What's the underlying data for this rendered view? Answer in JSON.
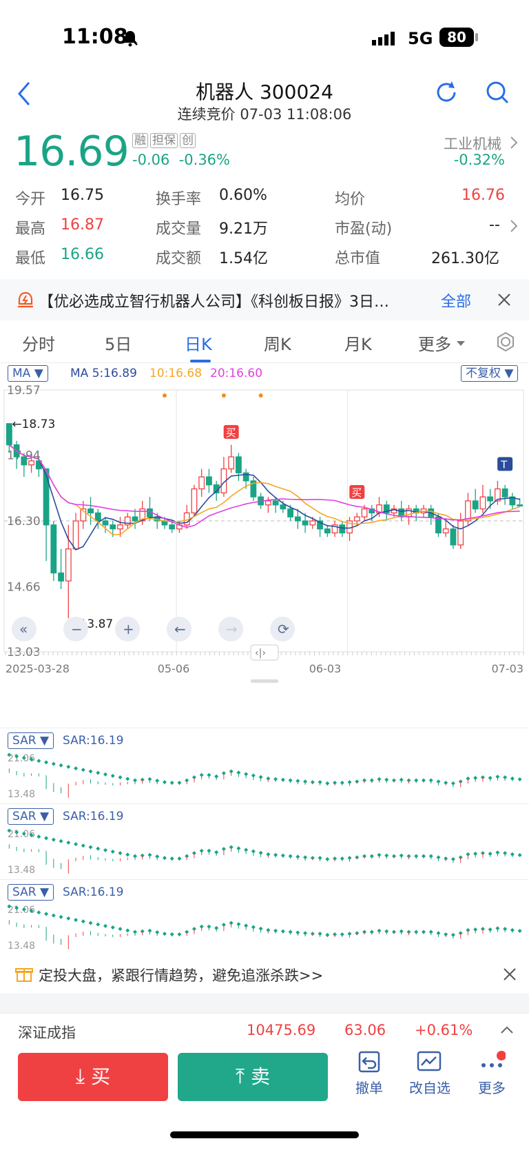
{
  "status_bar": {
    "time": "11:08",
    "network": "5G",
    "battery": "80"
  },
  "header": {
    "title": "机器人 300024",
    "subtitle": "连续竞价 07-03 11:08:06"
  },
  "quote": {
    "price": "16.69",
    "tags": [
      "融",
      "担保",
      "创"
    ],
    "change": "-0.06",
    "change_pct": "-0.36%",
    "industry": "工业机械",
    "industry_change": "-0.32%"
  },
  "stats": {
    "open_label": "今开",
    "open": "16.75",
    "high_label": "最高",
    "high": "16.87",
    "low_label": "最低",
    "low": "16.66",
    "turnover_label": "换手率",
    "turnover": "0.60%",
    "volume_label": "成交量",
    "volume": "9.21万",
    "amount_label": "成交额",
    "amount": "1.54亿",
    "avg_label": "均价",
    "avg": "16.76",
    "pe_label": "市盈(动)",
    "pe": "--",
    "mcap_label": "总市值",
    "mcap": "261.30亿"
  },
  "news": {
    "text": "【优必选成立智行机器人公司】《科创板日报》3日…",
    "all": "全部"
  },
  "tabs": [
    "分时",
    "5日",
    "日K",
    "周K",
    "月K",
    "更多"
  ],
  "chart": {
    "ma_button": "MA",
    "ma5": "MA 5:16.89",
    "ma10": "10:16.68",
    "ma20": "20:16.60",
    "adjust_button": "不复权",
    "y_ticks": [
      "19.57",
      "17.94",
      "16.30",
      "14.66",
      "13.03"
    ],
    "high_mark": "←18.73",
    "low_mark": "←13.87",
    "x_ticks": [
      "2025-03-28",
      "05-06",
      "06-03",
      "07-03"
    ],
    "buy_marker": "买",
    "t_marker": "T",
    "colors": {
      "up": "#f04142",
      "down": "#1aa486",
      "ma5": "#2b4c9b",
      "ma10": "#f5a623",
      "ma20": "#e040e0"
    }
  },
  "chart_data": {
    "type": "candlestick",
    "candles": [
      [
        18.73,
        18.2,
        18.73,
        18.0
      ],
      [
        18.2,
        17.9,
        18.3,
        17.6
      ],
      [
        17.9,
        17.7,
        18.0,
        17.4
      ],
      [
        17.7,
        17.8,
        17.9,
        17.5
      ],
      [
        17.8,
        17.6,
        17.9,
        17.4
      ],
      [
        17.6,
        16.2,
        17.6,
        15.3
      ],
      [
        16.2,
        15.0,
        16.3,
        14.8
      ],
      [
        15.0,
        14.8,
        15.6,
        14.6
      ],
      [
        14.8,
        15.6,
        16.2,
        13.87
      ],
      [
        15.6,
        16.3,
        16.5,
        15.9
      ],
      [
        16.3,
        16.6,
        16.8,
        16.1
      ],
      [
        16.6,
        16.5,
        16.9,
        16.2
      ],
      [
        16.5,
        16.3,
        16.6,
        16.1
      ],
      [
        16.3,
        16.2,
        16.4,
        16.0
      ],
      [
        16.2,
        16.1,
        16.3,
        15.9
      ],
      [
        16.1,
        16.2,
        16.4,
        15.9
      ],
      [
        16.2,
        16.4,
        16.5,
        16.1
      ],
      [
        16.4,
        16.3,
        16.6,
        16.1
      ],
      [
        16.3,
        16.6,
        16.8,
        16.2
      ],
      [
        16.6,
        16.4,
        16.9,
        16.3
      ],
      [
        16.4,
        16.3,
        16.5,
        16.1
      ],
      [
        16.3,
        16.2,
        16.4,
        16.1
      ],
      [
        16.2,
        16.1,
        16.3,
        16.0
      ],
      [
        16.1,
        16.2,
        16.3,
        16.0
      ],
      [
        16.2,
        16.5,
        16.7,
        16.1
      ],
      [
        16.5,
        17.1,
        17.2,
        16.4
      ],
      [
        17.1,
        17.4,
        17.6,
        16.9
      ],
      [
        17.4,
        17.2,
        17.6,
        17.0
      ],
      [
        17.2,
        17.0,
        17.3,
        16.8
      ],
      [
        17.0,
        17.6,
        17.9,
        16.9
      ],
      [
        17.6,
        17.9,
        18.2,
        17.5
      ],
      [
        17.9,
        17.5,
        18.0,
        17.3
      ],
      [
        17.5,
        17.3,
        17.6,
        17.1
      ],
      [
        17.3,
        16.9,
        17.4,
        16.8
      ],
      [
        16.9,
        16.7,
        17.0,
        16.6
      ],
      [
        16.7,
        16.8,
        16.9,
        16.5
      ],
      [
        16.8,
        16.7,
        16.9,
        16.5
      ],
      [
        16.7,
        16.6,
        16.8,
        16.5
      ],
      [
        16.6,
        16.4,
        16.7,
        16.3
      ],
      [
        16.4,
        16.3,
        16.6,
        16.1
      ],
      [
        16.3,
        16.2,
        16.5,
        16.0
      ],
      [
        16.2,
        16.3,
        16.4,
        16.1
      ],
      [
        16.3,
        16.1,
        16.4,
        15.9
      ],
      [
        16.1,
        16.0,
        16.2,
        15.9
      ],
      [
        16.0,
        16.2,
        16.3,
        15.9
      ],
      [
        16.2,
        16.0,
        16.3,
        15.9
      ],
      [
        16.0,
        16.3,
        16.4,
        15.8
      ],
      [
        16.3,
        16.4,
        16.5,
        16.2
      ],
      [
        16.4,
        16.6,
        16.7,
        16.3
      ],
      [
        16.6,
        16.5,
        16.7,
        16.3
      ],
      [
        16.5,
        16.7,
        16.9,
        16.4
      ],
      [
        16.7,
        16.5,
        16.8,
        16.3
      ],
      [
        16.5,
        16.6,
        16.7,
        16.4
      ],
      [
        16.6,
        16.4,
        16.8,
        16.3
      ],
      [
        16.4,
        16.6,
        16.7,
        16.2
      ],
      [
        16.6,
        16.5,
        16.7,
        16.3
      ],
      [
        16.5,
        16.6,
        16.7,
        16.4
      ],
      [
        16.6,
        16.4,
        16.7,
        16.2
      ],
      [
        16.4,
        16.0,
        16.5,
        15.9
      ],
      [
        16.0,
        16.1,
        16.3,
        15.9
      ],
      [
        16.1,
        15.7,
        16.2,
        15.6
      ],
      [
        15.7,
        16.3,
        16.5,
        15.6
      ],
      [
        16.3,
        16.8,
        17.0,
        16.2
      ],
      [
        16.8,
        16.6,
        17.1,
        16.5
      ],
      [
        16.6,
        16.9,
        17.2,
        16.5
      ],
      [
        16.9,
        16.8,
        17.1,
        16.6
      ],
      [
        16.8,
        17.1,
        17.3,
        16.7
      ],
      [
        17.1,
        16.9,
        17.2,
        16.7
      ],
      [
        16.9,
        16.7,
        17.0,
        16.6
      ],
      [
        16.7,
        16.69,
        16.87,
        16.66
      ]
    ],
    "ma5_last": 16.89,
    "ma10_last": 16.68,
    "ma20_last": 16.6,
    "ylim": [
      13.03,
      19.57
    ]
  },
  "sar_panels": [
    {
      "button": "SAR",
      "value": "SAR:16.19",
      "y_top": "21.06",
      "y_bottom": "13.48"
    },
    {
      "button": "SAR",
      "value": "SAR:16.19",
      "y_top": "21.06",
      "y_bottom": "13.48"
    },
    {
      "button": "SAR",
      "value": "SAR:16.19",
      "y_top": "21.06",
      "y_bottom": "13.48"
    }
  ],
  "promo": {
    "text": "定投大盘，紧跟行情趋势，避免追涨杀跌>>"
  },
  "index": {
    "name": "深证成指",
    "value": "10475.69",
    "change": "63.06",
    "pct": "+0.61%"
  },
  "bottom": {
    "buy": "买",
    "sell": "卖",
    "cancel": "撤单",
    "watchlist": "改自选",
    "more": "更多"
  }
}
